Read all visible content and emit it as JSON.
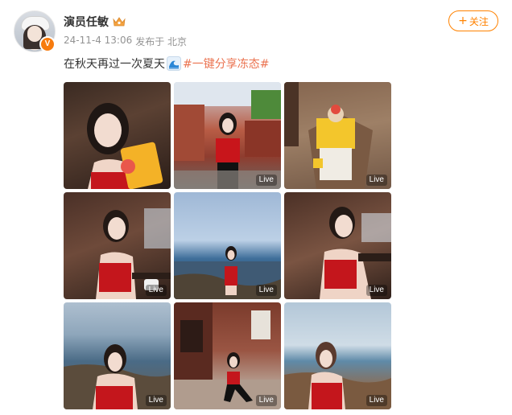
{
  "post": {
    "username": "演员任敏",
    "date": "24-11-4 13:06",
    "source": "发布于 北京",
    "text": "在秋天再过一次夏天",
    "hashtag": "#一键分享冻态#",
    "follow_label": "关注",
    "verify_mark": "V"
  },
  "icons": {
    "crown": "crown-icon",
    "wave": "wave-icon",
    "plus": "plus-icon"
  },
  "colors": {
    "accent": "#ff8200",
    "hashtag": "#eb7350",
    "verify": "#f77b0e"
  },
  "photos": [
    {
      "live": ""
    },
    {
      "live": "Live"
    },
    {
      "live": "Live"
    },
    {
      "live": "Live"
    },
    {
      "live": "Live"
    },
    {
      "live": "Live"
    },
    {
      "live": "Live"
    },
    {
      "live": "Live"
    },
    {
      "live": "Live"
    }
  ]
}
